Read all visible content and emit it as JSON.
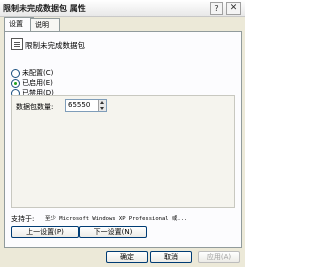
{
  "window": {
    "title": "限制未完成数据包 属性",
    "help": "?",
    "close": "✕"
  },
  "tabs": [
    {
      "label": "设置"
    },
    {
      "label": "说明"
    }
  ],
  "policy": {
    "name": "限制未完成数据包",
    "icon": "policy-document-icon"
  },
  "options": [
    {
      "label": "未配置(C)",
      "checked": false
    },
    {
      "label": "已启用(E)",
      "checked": true
    },
    {
      "label": "已禁用(D)",
      "checked": false
    }
  ],
  "field": {
    "label": "数据包数量:",
    "value": "65550"
  },
  "supported": {
    "label": "支持于:",
    "value": "至少 Microsoft Windows XP Professional 或..."
  },
  "nav": {
    "prev": "上一设置(P)",
    "next": "下一设置(N)"
  },
  "buttons": {
    "ok": "确定",
    "cancel": "取消",
    "apply": "应用(A)"
  }
}
